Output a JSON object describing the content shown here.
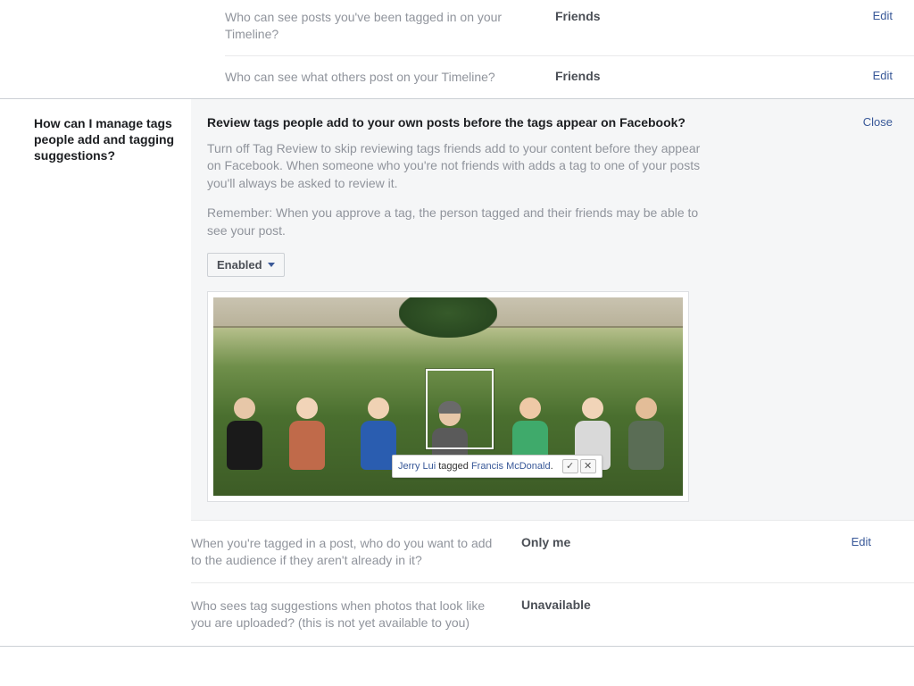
{
  "upperSection": {
    "rows": [
      {
        "label": "Who can see posts you've been tagged in on your Timeline?",
        "value": "Friends",
        "action": "Edit"
      },
      {
        "label": "Who can see what others post on your Timeline?",
        "value": "Friends",
        "action": "Edit"
      }
    ]
  },
  "expanded": {
    "sideHeading": "How can I manage tags people add and tagging suggestions?",
    "title": "Review tags people add to your own posts before the tags appear on Facebook?",
    "closeLabel": "Close",
    "desc1": "Turn off Tag Review to skip reviewing tags friends add to your content before they appear on Facebook. When someone who you're not friends with adds a tag to one of your posts you'll always be asked to review it.",
    "desc2": "Remember: When you approve a tag, the person tagged and their friends may be able to see your post.",
    "dropdownValue": "Enabled",
    "tagExample": {
      "tagger": "Jerry Lui",
      "middle": " tagged ",
      "tagged": "Francis McDonald",
      "end": "."
    },
    "subRows": [
      {
        "label": "When you're tagged in a post, who do you want to add to the audience if they aren't already in it?",
        "value": "Only me",
        "action": "Edit"
      },
      {
        "label": "Who sees tag suggestions when photos that look like you are uploaded? (this is not yet available to you)",
        "value": "Unavailable",
        "action": ""
      }
    ]
  }
}
